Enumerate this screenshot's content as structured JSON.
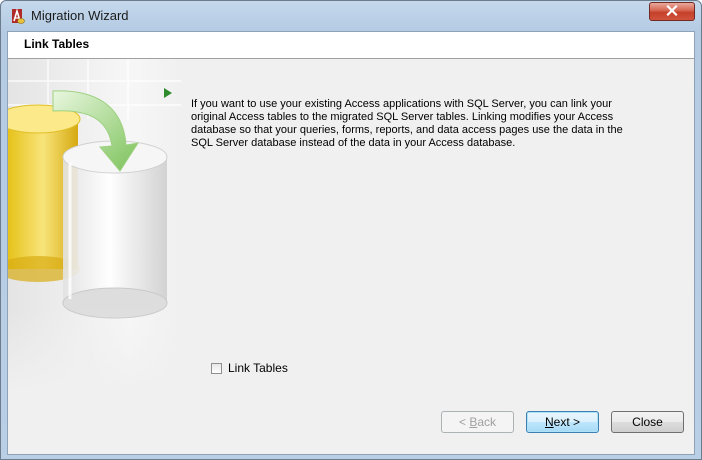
{
  "window": {
    "title": "Migration Wizard"
  },
  "header": {
    "title": "Link Tables"
  },
  "description": "If you want to use your existing Access applications with SQL Server, you can link your original Access tables to the migrated SQL Server tables. Linking modifies your Access database so that your queries, forms, reports, and data access pages use the data in the SQL Server database instead of the data in your Access database.",
  "link_tables_checkbox": {
    "label": "Link Tables",
    "checked": false
  },
  "buttons": {
    "back": {
      "prefix": "< ",
      "mnemonic": "B",
      "rest": "ack",
      "enabled": false
    },
    "next": {
      "mnemonic": "N",
      "rest": "ext >",
      "enabled": true
    },
    "close": {
      "label": "Close",
      "enabled": true
    }
  },
  "colors": {
    "accent_arrow": "#2e8b2e",
    "client_bg": "#f0f0f0",
    "close_red": "#c6402a"
  }
}
